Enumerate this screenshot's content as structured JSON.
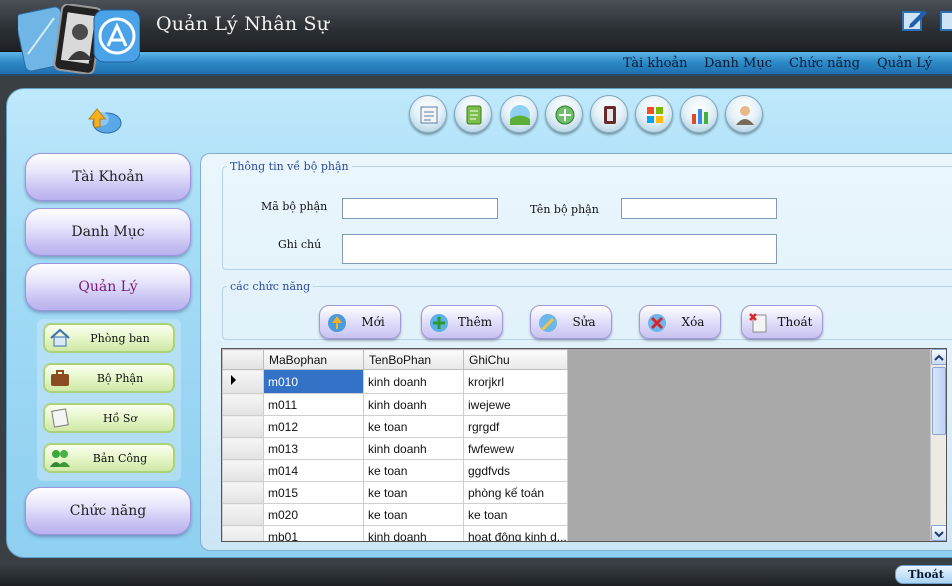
{
  "app": {
    "title": "Quản Lý Nhân Sự"
  },
  "menu": [
    {
      "label": "Tài khoản"
    },
    {
      "label": "Danh Mục"
    },
    {
      "label": "Chức năng"
    },
    {
      "label": "Quản Lý"
    }
  ],
  "toolbar_icons": [
    "book-icon",
    "notepad-icon",
    "landscape-icon",
    "globe-plus-icon",
    "contacts-icon",
    "windows-icon",
    "chart-icon",
    "user-icon"
  ],
  "sidebar": {
    "items": [
      {
        "label": "Tài Khoản"
      },
      {
        "label": "Danh Mục"
      },
      {
        "label": "Quản Lý",
        "active": true
      },
      {
        "label": "Chức năng"
      }
    ],
    "submenu": [
      {
        "label": "Phòng ban",
        "icon": "house-icon"
      },
      {
        "label": "Bộ Phận",
        "icon": "briefcase-icon"
      },
      {
        "label": "Hồ Sơ",
        "icon": "document-icon"
      },
      {
        "label": "Bản Công",
        "icon": "people-icon"
      }
    ]
  },
  "form": {
    "legend": "Thông tin về bộ phận",
    "ma_label": "Mã bộ phận",
    "ma_value": "",
    "ten_label": "Tên bộ phận",
    "ten_value": "",
    "ghichu_label": "Ghi chú",
    "ghichu_value": ""
  },
  "functions": {
    "legend": "các chức năng",
    "buttons": [
      {
        "label": "Mới"
      },
      {
        "label": "Thêm"
      },
      {
        "label": "Sửa"
      },
      {
        "label": "Xóa"
      },
      {
        "label": "Thoát"
      }
    ]
  },
  "grid": {
    "columns": [
      "MaBophan",
      "TenBoPhan",
      "GhiChu"
    ],
    "rows": [
      [
        "m010",
        "kinh doanh",
        "krorjkrl"
      ],
      [
        "m011",
        "kinh doanh",
        "iwejewe"
      ],
      [
        "m012",
        "ke toan",
        "rgrgdf"
      ],
      [
        "m013",
        "kinh doanh",
        "fwfewew"
      ],
      [
        "m014",
        "ke toan",
        "ggdfvds"
      ],
      [
        "m015",
        "ke toan",
        "phòng kế toán"
      ],
      [
        "m020",
        "ke toan",
        "ke toan"
      ],
      [
        "mb01",
        "kinh doanh",
        "hoạt động kinh d..."
      ]
    ]
  },
  "colors": {
    "menubar": "#2e8bc8",
    "selection": "#3472c8",
    "legend": "#2c4a9a"
  },
  "footer": {
    "exit_label": "Thoát"
  }
}
